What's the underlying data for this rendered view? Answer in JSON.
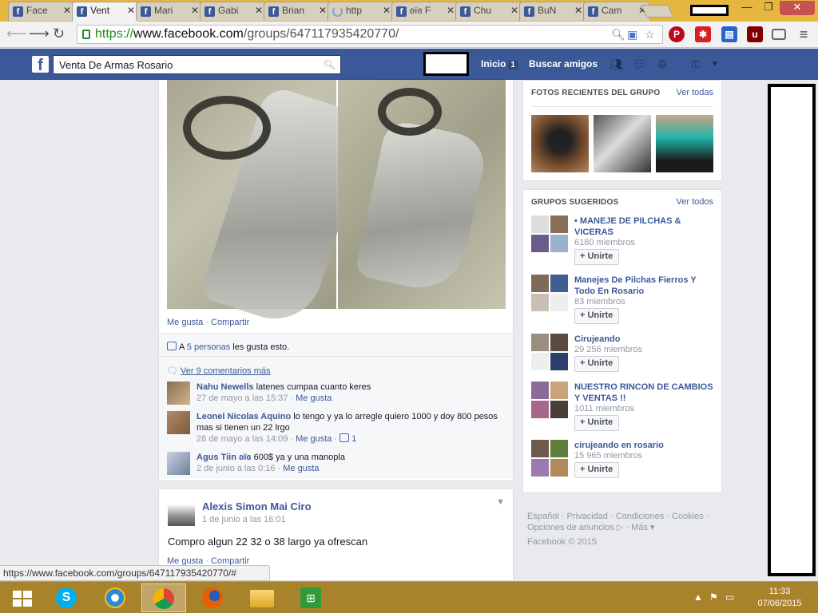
{
  "browser": {
    "tabs": [
      {
        "label": "Face",
        "active": false
      },
      {
        "label": "Vent",
        "active": true
      },
      {
        "label": "Mari",
        "active": false
      },
      {
        "label": "Gabi",
        "active": false
      },
      {
        "label": "Brian",
        "active": false
      },
      {
        "label": "http",
        "active": false
      },
      {
        "label": "ʚïɞ F",
        "active": false
      },
      {
        "label": "Chu",
        "active": false
      },
      {
        "label": "BuN",
        "active": false
      },
      {
        "label": "Cam",
        "active": false
      }
    ],
    "url_scheme": "https://",
    "url_host": "www.facebook.com",
    "url_path": "/groups/647117935420770/",
    "status_url": "https://www.facebook.com/groups/647117935420770/#"
  },
  "fb": {
    "logo": "f",
    "search_value": "Venta De Armas Rosario",
    "nav_home": "Inicio",
    "nav_home_count": "1",
    "nav_find_friends": "Buscar amigos"
  },
  "post1": {
    "actions": {
      "like": "Me gusta",
      "sep": "·",
      "share": "Compartir"
    },
    "likes_prefix": "A ",
    "likes_link": "5 personas",
    "likes_suffix": " les gusta esto.",
    "view_comments": "Ver 9 comentarios más",
    "comments": [
      {
        "name": "Nahu Newells",
        "text": "latenes cumpaa cuanto keres",
        "date": "27 de mayo a las 15:37",
        "like": "Me gusta",
        "likes": ""
      },
      {
        "name": "Leonel Nicolas Aquino",
        "text": "lo tengo y ya lo arregle quiero 1000 y doy 800 pesos mas si tienen un 22 lrgo",
        "date": "28 de mayo a las 14:09",
        "like": "Me gusta",
        "likes": "1"
      },
      {
        "name": "Agus Tiin ʚïɞ",
        "text": "600$ ya y una manopla",
        "date": "2 de junio a las 0:16",
        "like": "Me gusta",
        "likes": ""
      }
    ]
  },
  "post2": {
    "author": "Alexis Simon Mai Ciro",
    "date": "1 de junio a las 16:01",
    "text": "Compro algun 22 32 o 38 largo ya ofrescan",
    "like": "Me gusta",
    "share": "Compartir"
  },
  "sidebar": {
    "photos_title": "FOTOS RECIENTES DEL GRUPO",
    "photos_link": "Ver todas",
    "groups_title": "GRUPOS SUGERIDOS",
    "groups_link": "Ver todos",
    "join_label": "Unirte",
    "groups": [
      {
        "name": "• MANEJE DE PILCHAS & VICERAS",
        "members": "6180 miembros"
      },
      {
        "name": "Manejes De Pilchas Fierros Y Todo En Rosario",
        "members": "83 miembros"
      },
      {
        "name": "Cirujeando",
        "members": "29 256 miembros"
      },
      {
        "name": "NUESTRO RINCON DE CAMBIOS Y VENTAS !!",
        "members": "1011 miembros"
      },
      {
        "name": "cirujeando en rosario",
        "members": "15 965 miembros"
      }
    ]
  },
  "footer": {
    "links": [
      "Español",
      "Privacidad",
      "Condiciones",
      "Cookies",
      "Opciones de anuncios",
      "Más"
    ],
    "copyright": "Facebook © 2015"
  },
  "taskbar": {
    "time": "11:33",
    "date": "07/06/2015"
  },
  "colors": {
    "fb_blue": "#3b5998",
    "taskbar": "#a9832b",
    "tabbar": "#e5b73f"
  }
}
